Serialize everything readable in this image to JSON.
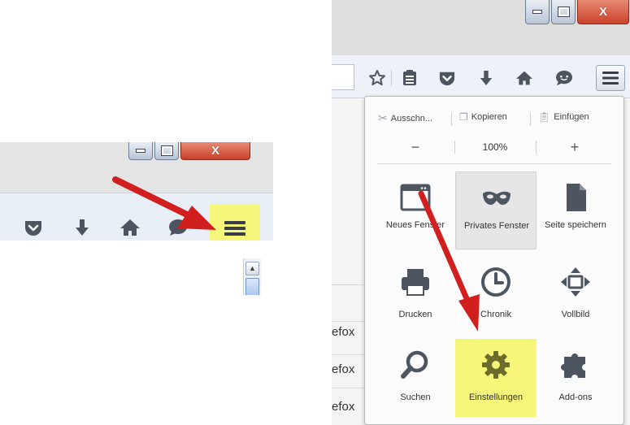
{
  "left_view": {
    "window_buttons": {
      "minimize": "minimize",
      "maximize": "maximize",
      "close": "X"
    },
    "toolbar_icons": [
      "pocket-icon",
      "download-icon",
      "home-icon",
      "chat-icon",
      "menu-icon"
    ],
    "scroll_up": "▲",
    "highlight_color": "#f5f67a"
  },
  "right_view": {
    "window_buttons": {
      "minimize": "minimize",
      "maximize": "maximize",
      "close": "X"
    },
    "toolbar_icons": [
      "bookmark-star-icon",
      "reading-list-icon",
      "pocket-icon",
      "download-icon",
      "home-icon",
      "chat-icon",
      "menu-icon"
    ],
    "background_text": [
      "efox",
      "efox",
      "efox"
    ],
    "menu": {
      "edit": {
        "cut": "Ausschn...",
        "copy": "Kopieren",
        "paste": "Einfügen"
      },
      "zoom": {
        "minus": "−",
        "level": "100%",
        "plus": "+"
      },
      "tiles": [
        {
          "label": "Neues Fenster"
        },
        {
          "label": "Privates Fenster"
        },
        {
          "label": "Seite speichern"
        },
        {
          "label": "Drucken"
        },
        {
          "label": "Chronik"
        },
        {
          "label": "Vollbild"
        },
        {
          "label": "Suchen"
        },
        {
          "label": "Einstellungen"
        },
        {
          "label": "Add-ons"
        }
      ]
    },
    "highlight_color": "#f5f67a"
  },
  "arrow_color": "#d11f1f"
}
